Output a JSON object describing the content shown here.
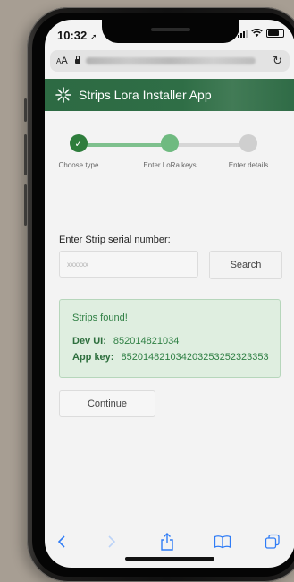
{
  "status_bar": {
    "time": "10:32"
  },
  "browser": {
    "text_size_label": "AA",
    "reload_icon": "reload-icon"
  },
  "app": {
    "title": "Strips Lora Installer App",
    "accent": "#2f6e46"
  },
  "stepper": {
    "steps": [
      {
        "label": "Choose type",
        "state": "completed",
        "color": "#2e7d3c"
      },
      {
        "label": "Enter LoRa keys",
        "state": "active",
        "color": "#6fba80"
      },
      {
        "label": "Enter details",
        "state": "pending",
        "color": "#cfcfcf"
      }
    ]
  },
  "serial": {
    "label": "Enter Strip serial number:",
    "placeholder": "xxxxxx",
    "search_label": "Search"
  },
  "found": {
    "title": "Strips found!",
    "dev_ui_label": "Dev UI:",
    "dev_ui_value": "852014821034",
    "app_key_label": "App key:",
    "app_key_value": "852014821034203253252323353"
  },
  "continue_label": "Continue",
  "toolbar": {
    "icons": [
      "back-icon",
      "forward-icon",
      "share-icon",
      "bookmarks-icon",
      "tabs-icon"
    ],
    "color": "#2f7cf6"
  }
}
